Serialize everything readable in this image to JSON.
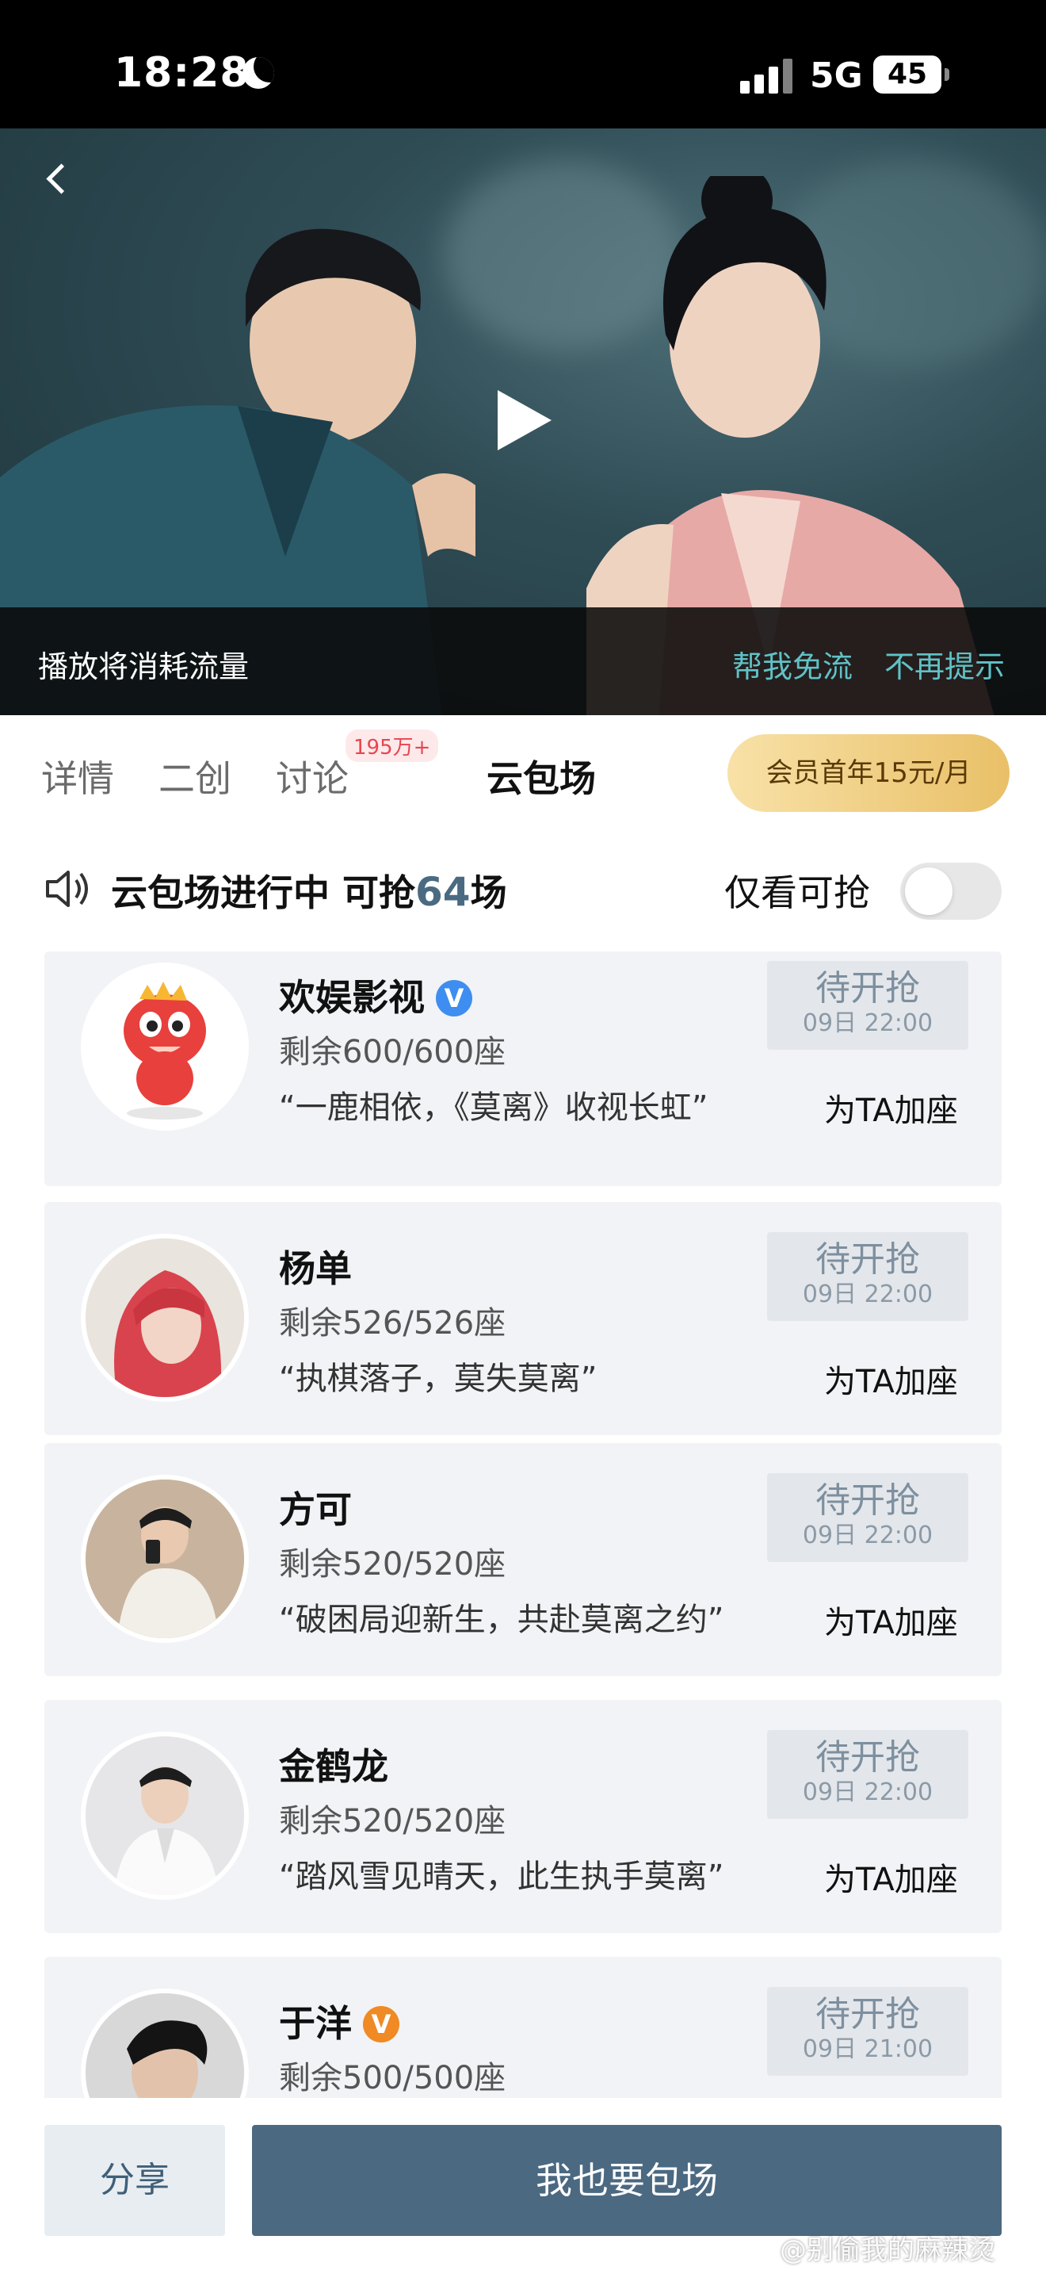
{
  "status_bar": {
    "time": "18:28",
    "network": "5G",
    "battery": "45"
  },
  "video": {
    "data_warning": "播放将消耗流量",
    "free_data_link": "帮我免流",
    "dont_remind_link": "不再提示"
  },
  "tabs": [
    {
      "label": "详情"
    },
    {
      "label": "二创"
    },
    {
      "label": "讨论",
      "badge": "195万+"
    },
    {
      "label": "云包场"
    }
  ],
  "vip": {
    "label": "会员首年15元/月"
  },
  "header": {
    "title_prefix": "云包场进行中 可抢",
    "count": "64",
    "title_suffix": "场",
    "only_available_label": "仅看可抢",
    "only_available_on": false
  },
  "screenings": [
    {
      "name": "欢娱影视",
      "verified": "V",
      "seats": "剩余600/600座",
      "quote": "“一鹿相依，《莫离》收视长虹”",
      "status": "待开抢",
      "time": "09日 22:00",
      "action": "为TA加座"
    },
    {
      "name": "杨单",
      "verified": "",
      "seats": "剩余526/526座",
      "quote": "“执棋落子，莫失莫离”",
      "status": "待开抢",
      "time": "09日 22:00",
      "action": "为TA加座"
    },
    {
      "name": "方可",
      "verified": "",
      "seats": "剩余520/520座",
      "quote": "“破困局迎新生，共赴莫离之约”",
      "status": "待开抢",
      "time": "09日 22:00",
      "action": "为TA加座"
    },
    {
      "name": "金鹤龙",
      "verified": "",
      "seats": "剩余520/520座",
      "quote": "“踏风雪见晴天，此生执手莫离”",
      "status": "待开抢",
      "time": "09日 22:00",
      "action": "为TA加座"
    },
    {
      "name": "于洋",
      "verified": "V",
      "seats": "剩余500/500座",
      "quote": "",
      "status": "待开抢",
      "time": "09日 21:00",
      "action": ""
    }
  ],
  "bottom": {
    "share_label": "分享",
    "book_label": "我也要包场"
  },
  "watermark": "@别偷我的麻辣烫",
  "colors": {
    "accent": "#4b6981",
    "link": "#5fc2c7",
    "vip_gold": "#e9c068",
    "badge_red": "#e8464f",
    "verified_blue": "#3d8ef0",
    "verified_orange": "#f08a24"
  }
}
